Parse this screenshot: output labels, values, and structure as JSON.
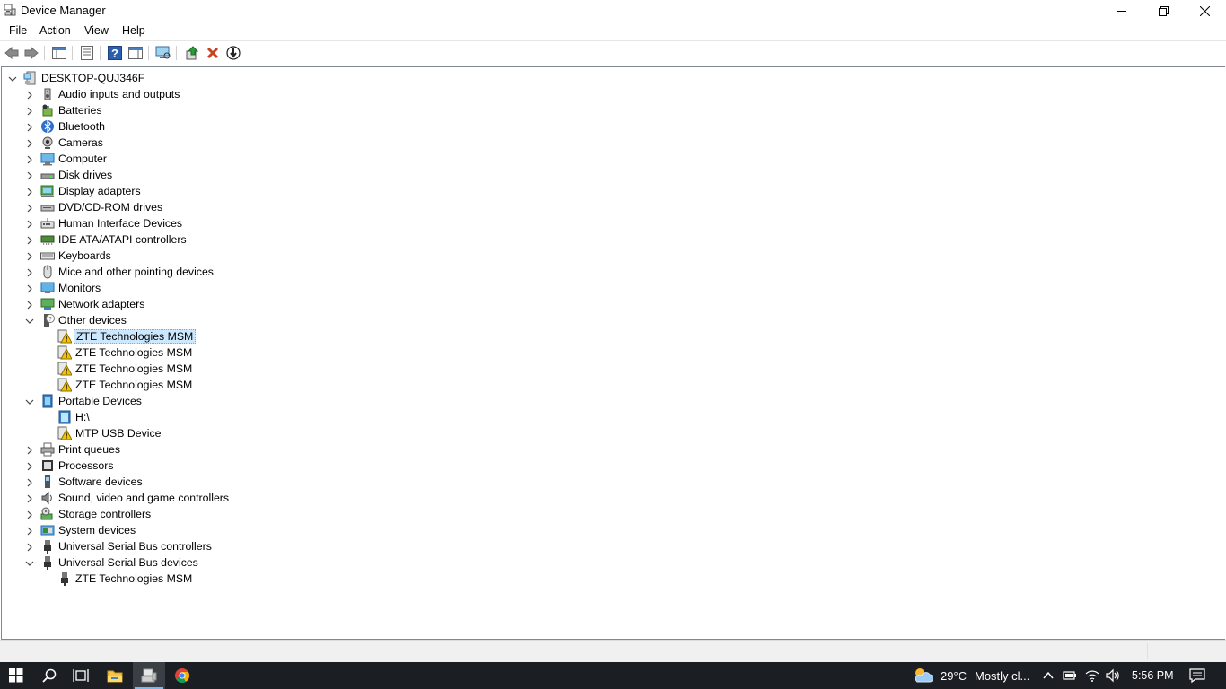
{
  "window": {
    "title": "Device Manager",
    "minimize_icon": "minimize-icon",
    "maximize_icon": "restore-icon",
    "close_icon": "close-icon"
  },
  "menu": [
    "File",
    "Action",
    "View",
    "Help"
  ],
  "toolbar": {
    "icons": [
      "back-arrow-icon",
      "forward-arrow-icon",
      "show-hide-console-tree-icon",
      "properties-icon",
      "help-icon",
      "action-pane-icon",
      "scan-hardware-icon",
      "update-driver-icon",
      "uninstall-device-icon",
      "disable-device-icon"
    ]
  },
  "tree": {
    "root": "DESKTOP-QUJ346F",
    "items": [
      {
        "label": "Audio inputs and outputs",
        "icon": "speaker-icon",
        "expanded": false
      },
      {
        "label": "Batteries",
        "icon": "battery-icon",
        "expanded": false
      },
      {
        "label": "Bluetooth",
        "icon": "bluetooth-icon",
        "expanded": false
      },
      {
        "label": "Cameras",
        "icon": "camera-icon",
        "expanded": false
      },
      {
        "label": "Computer",
        "icon": "computer-icon",
        "expanded": false
      },
      {
        "label": "Disk drives",
        "icon": "disk-drive-icon",
        "expanded": false
      },
      {
        "label": "Display adapters",
        "icon": "display-adapter-icon",
        "expanded": false
      },
      {
        "label": "DVD/CD-ROM drives",
        "icon": "dvd-drive-icon",
        "expanded": false
      },
      {
        "label": "Human Interface Devices",
        "icon": "hid-icon",
        "expanded": false
      },
      {
        "label": "IDE ATA/ATAPI controllers",
        "icon": "ide-controller-icon",
        "expanded": false
      },
      {
        "label": "Keyboards",
        "icon": "keyboard-icon",
        "expanded": false
      },
      {
        "label": "Mice and other pointing devices",
        "icon": "mouse-icon",
        "expanded": false
      },
      {
        "label": "Monitors",
        "icon": "monitor-icon",
        "expanded": false
      },
      {
        "label": "Network adapters",
        "icon": "network-adapter-icon",
        "expanded": false
      },
      {
        "label": "Other devices",
        "icon": "unknown-device-icon",
        "expanded": true,
        "children": [
          {
            "label": "ZTE Technologies MSM",
            "icon": "warning-device-icon",
            "selected": true
          },
          {
            "label": "ZTE Technologies MSM",
            "icon": "warning-device-icon"
          },
          {
            "label": "ZTE Technologies MSM",
            "icon": "warning-device-icon"
          },
          {
            "label": "ZTE Technologies MSM",
            "icon": "warning-device-icon"
          }
        ]
      },
      {
        "label": "Portable Devices",
        "icon": "portable-device-icon",
        "expanded": true,
        "children": [
          {
            "label": "H:\\",
            "icon": "portable-drive-icon"
          },
          {
            "label": "MTP USB Device",
            "icon": "warning-device-icon"
          }
        ]
      },
      {
        "label": "Print queues",
        "icon": "printer-icon",
        "expanded": false
      },
      {
        "label": "Processors",
        "icon": "processor-icon",
        "expanded": false
      },
      {
        "label": "Software devices",
        "icon": "software-device-icon",
        "expanded": false
      },
      {
        "label": "Sound, video and game controllers",
        "icon": "sound-controller-icon",
        "expanded": false
      },
      {
        "label": "Storage controllers",
        "icon": "storage-controller-icon",
        "expanded": false
      },
      {
        "label": "System devices",
        "icon": "system-device-icon",
        "expanded": false
      },
      {
        "label": "Universal Serial Bus controllers",
        "icon": "usb-icon",
        "expanded": false
      },
      {
        "label": "Universal Serial Bus devices",
        "icon": "usb-icon",
        "expanded": true,
        "children": [
          {
            "label": "ZTE Technologies MSM",
            "icon": "usb-device-icon"
          }
        ]
      }
    ]
  },
  "taskbar": {
    "apps": [
      "start-icon",
      "search-icon",
      "task-view-icon",
      "file-explorer-icon",
      "device-manager-icon",
      "chrome-icon"
    ],
    "weather": {
      "icon": "partly-cloudy-icon",
      "temp": "29°C",
      "condition": "Mostly cl..."
    },
    "tray_icons": [
      "chevron-up-icon",
      "battery-icon",
      "wifi-icon",
      "volume-icon"
    ],
    "time": "5:56 PM",
    "notification_icon": "action-center-icon"
  },
  "colors": {
    "selection": "#cce8ff",
    "taskbar": "#1b1f24",
    "accent": "#0078d7"
  }
}
